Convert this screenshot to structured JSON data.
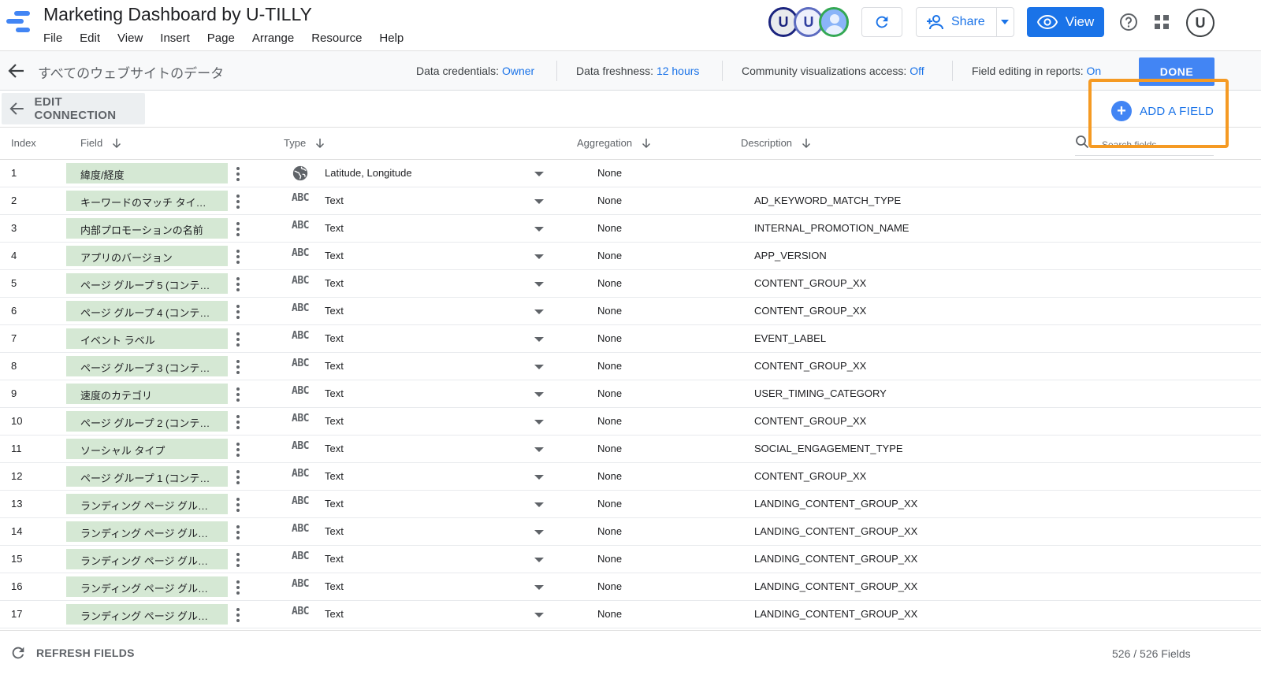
{
  "app": {
    "title": "Marketing Dashboard by U-TILLY",
    "menu": [
      "File",
      "Edit",
      "View",
      "Insert",
      "Page",
      "Arrange",
      "Resource",
      "Help"
    ],
    "share_label": "Share",
    "view_label": "View",
    "avatar_letters": [
      "U",
      "U"
    ],
    "user_letter": "U",
    "accent_color": "#1a73e8"
  },
  "credentials_bar": {
    "data_source_name": "すべてのウェブサイトのデータ",
    "data_credentials_label": "Data credentials: ",
    "data_credentials_value": "Owner",
    "data_freshness_label": "Data freshness: ",
    "data_freshness_value": "12 hours",
    "community_label": "Community visualizations access: ",
    "community_value": "Off",
    "field_editing_label": "Field editing in reports: ",
    "field_editing_value": "On",
    "done_label": "DONE"
  },
  "edit_bar": {
    "edit_connection_label": "EDIT CONNECTION",
    "add_field_label": "ADD A FIELD",
    "highlight_color": "#f59a23"
  },
  "columns": {
    "index": "Index",
    "field": "Field",
    "type": "Type",
    "aggregation": "Aggregation",
    "description": "Description",
    "search_placeholder": "Search fields"
  },
  "rows": [
    {
      "index": "1",
      "field": "緯度/経度",
      "type_icon": "globe-icon",
      "type": "Latitude, Longitude",
      "aggregation": "None",
      "description": ""
    },
    {
      "index": "2",
      "field": "キーワードのマッチ タイ…",
      "type_icon": "text-abc-icon",
      "type": "Text",
      "aggregation": "None",
      "description": "AD_KEYWORD_MATCH_TYPE"
    },
    {
      "index": "3",
      "field": "内部プロモーションの名前",
      "type_icon": "text-abc-icon",
      "type": "Text",
      "aggregation": "None",
      "description": "INTERNAL_PROMOTION_NAME"
    },
    {
      "index": "4",
      "field": "アプリのバージョン",
      "type_icon": "text-abc-icon",
      "type": "Text",
      "aggregation": "None",
      "description": "APP_VERSION"
    },
    {
      "index": "5",
      "field": "ページ グループ 5 (コンテ…",
      "type_icon": "text-abc-icon",
      "type": "Text",
      "aggregation": "None",
      "description": "CONTENT_GROUP_XX"
    },
    {
      "index": "6",
      "field": "ページ グループ 4 (コンテ…",
      "type_icon": "text-abc-icon",
      "type": "Text",
      "aggregation": "None",
      "description": "CONTENT_GROUP_XX"
    },
    {
      "index": "7",
      "field": "イベント ラベル",
      "type_icon": "text-abc-icon",
      "type": "Text",
      "aggregation": "None",
      "description": "EVENT_LABEL"
    },
    {
      "index": "8",
      "field": "ページ グループ 3 (コンテ…",
      "type_icon": "text-abc-icon",
      "type": "Text",
      "aggregation": "None",
      "description": "CONTENT_GROUP_XX"
    },
    {
      "index": "9",
      "field": "速度のカテゴリ",
      "type_icon": "text-abc-icon",
      "type": "Text",
      "aggregation": "None",
      "description": "USER_TIMING_CATEGORY"
    },
    {
      "index": "10",
      "field": "ページ グループ 2 (コンテ…",
      "type_icon": "text-abc-icon",
      "type": "Text",
      "aggregation": "None",
      "description": "CONTENT_GROUP_XX"
    },
    {
      "index": "11",
      "field": "ソーシャル タイプ",
      "type_icon": "text-abc-icon",
      "type": "Text",
      "aggregation": "None",
      "description": "SOCIAL_ENGAGEMENT_TYPE"
    },
    {
      "index": "12",
      "field": "ページ グループ 1 (コンテ…",
      "type_icon": "text-abc-icon",
      "type": "Text",
      "aggregation": "None",
      "description": "CONTENT_GROUP_XX"
    },
    {
      "index": "13",
      "field": "ランディング ページ グル…",
      "type_icon": "text-abc-icon",
      "type": "Text",
      "aggregation": "None",
      "description": "LANDING_CONTENT_GROUP_XX"
    },
    {
      "index": "14",
      "field": "ランディング ページ グル…",
      "type_icon": "text-abc-icon",
      "type": "Text",
      "aggregation": "None",
      "description": "LANDING_CONTENT_GROUP_XX"
    },
    {
      "index": "15",
      "field": "ランディング ページ グル…",
      "type_icon": "text-abc-icon",
      "type": "Text",
      "aggregation": "None",
      "description": "LANDING_CONTENT_GROUP_XX"
    },
    {
      "index": "16",
      "field": "ランディング ページ グル…",
      "type_icon": "text-abc-icon",
      "type": "Text",
      "aggregation": "None",
      "description": "LANDING_CONTENT_GROUP_XX"
    },
    {
      "index": "17",
      "field": "ランディング ページ グル…",
      "type_icon": "text-abc-icon",
      "type": "Text",
      "aggregation": "None",
      "description": "LANDING_CONTENT_GROUP_XX"
    }
  ],
  "footer": {
    "refresh_label": "REFRESH FIELDS",
    "field_count": "526 / 526 Fields"
  }
}
